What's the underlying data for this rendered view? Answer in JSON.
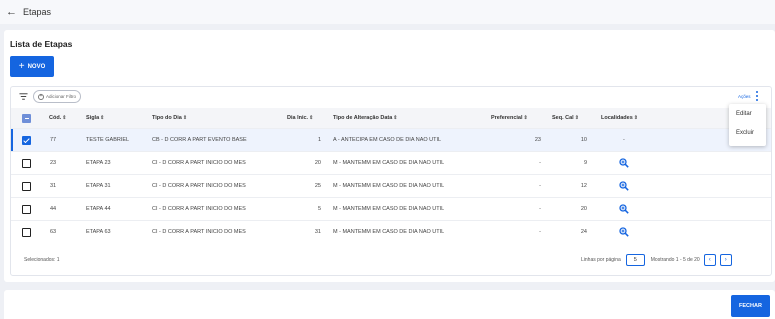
{
  "header": {
    "back_icon": "arrow-left-icon",
    "title": "Etapas"
  },
  "card": {
    "title": "Lista de Etapas",
    "new_label": "NOVO"
  },
  "filter": {
    "add_label": "Adicionar Filtro",
    "actions_label": "Ações"
  },
  "table": {
    "columns": {
      "cod": "Cód.",
      "sigla": "Sigla",
      "tipo_dia": "Tipo do Dia",
      "dia_inic": "Dia Inic.",
      "tipo_alteracao": "Tipo de Alteração Data",
      "preferencial": "Preferencial",
      "seq_cal": "Seq. Cal",
      "localidades": "Localidades"
    },
    "sort_glyph": "⇕",
    "rows": [
      {
        "cod": "77",
        "sigla": "TESTE GABRIEL",
        "tipo_dia": "CB - D CORR A PART EVENTO BASE",
        "dia_inic": "1",
        "tipo_alteracao": "A - ANTECIPA EM CASO DE DIA NAO UTIL",
        "preferencial": "23",
        "seq_cal": "10",
        "localidades": "-",
        "selected": true
      },
      {
        "cod": "23",
        "sigla": "ETAPA 23",
        "tipo_dia": "CI - D CORR A PART INICIO DO MES",
        "dia_inic": "20",
        "tipo_alteracao": "M - MANTEMM EM CASO DE DIA NAO UTIL",
        "preferencial": "-",
        "seq_cal": "9",
        "localidades": "",
        "selected": false
      },
      {
        "cod": "31",
        "sigla": "ETAPA 31",
        "tipo_dia": "CI - D CORR A PART INICIO DO MES",
        "dia_inic": "25",
        "tipo_alteracao": "M - MANTEMM EM CASO DE DIA NAO UTIL",
        "preferencial": "-",
        "seq_cal": "12",
        "localidades": "",
        "selected": false
      },
      {
        "cod": "44",
        "sigla": "ETAPA 44",
        "tipo_dia": "CI - D CORR A PART INICIO DO MES",
        "dia_inic": "5",
        "tipo_alteracao": "M - MANTEMM EM CASO DE DIA NAO UTIL",
        "preferencial": "-",
        "seq_cal": "20",
        "localidades": "",
        "selected": false
      },
      {
        "cod": "63",
        "sigla": "ETAPA 63",
        "tipo_dia": "CI - D CORR A PART INICIO DO MES",
        "dia_inic": "31",
        "tipo_alteracao": "M - MANTEMM EM CASO DE DIA NAO UTIL",
        "preferencial": "-",
        "seq_cal": "24",
        "localidades": "",
        "selected": false
      }
    ]
  },
  "footer": {
    "selected_label": "Selecionados: 1",
    "rows_per_page_label": "Linhas por página",
    "rows_per_page_value": "5",
    "range_label": "Mostrando 1 - 5 de 20",
    "prev_glyph": "‹",
    "next_glyph": "›"
  },
  "menu": {
    "edit_label": "Editar",
    "delete_label": "Excluir"
  },
  "bottom": {
    "close_label": "FECHAR"
  },
  "colors": {
    "primary": "#1565e0",
    "selected_row": "#eef3fd",
    "background": "#eef0f5"
  }
}
